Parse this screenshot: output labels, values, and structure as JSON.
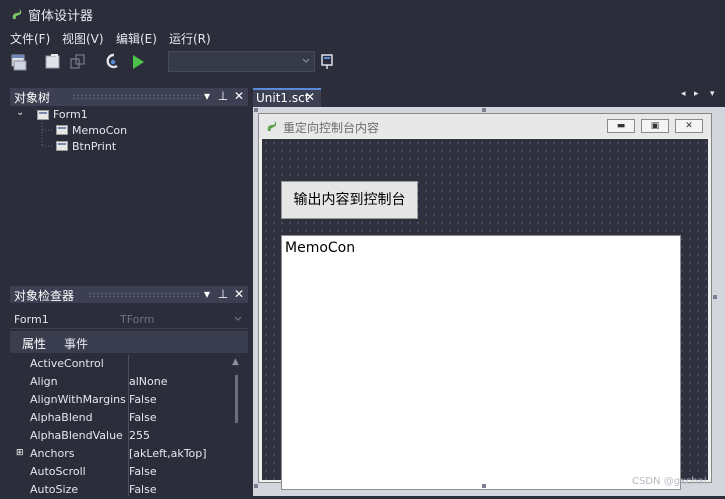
{
  "app": {
    "title": "窗体设计器"
  },
  "menu": [
    {
      "label": "文件(F)"
    },
    {
      "label": "视图(V)"
    },
    {
      "label": "编辑(E)"
    },
    {
      "label": "运行(R)"
    }
  ],
  "toolbar": {
    "combo_value": ""
  },
  "tree_panel": {
    "title": "对象树",
    "nodes": [
      {
        "label": "Form1"
      },
      {
        "label": "MemoCon"
      },
      {
        "label": "BtnPrint"
      }
    ]
  },
  "inspector": {
    "title": "对象检查器",
    "selected_object": "Form1",
    "selected_type": "TForm",
    "tabs": [
      "属性",
      "事件"
    ],
    "properties": [
      {
        "name": "ActiveControl",
        "value": ""
      },
      {
        "name": "Align",
        "value": "alNone"
      },
      {
        "name": "AlignWithMargins",
        "value": "False"
      },
      {
        "name": "AlphaBlend",
        "value": "False"
      },
      {
        "name": "AlphaBlendValue",
        "value": "255"
      },
      {
        "name": "Anchors",
        "value": "[akLeft,akTop]"
      },
      {
        "name": "AutoScroll",
        "value": "False"
      },
      {
        "name": "AutoSize",
        "value": "False"
      }
    ]
  },
  "editor": {
    "tab_label": "Unit1.sct",
    "form": {
      "caption": "重定向控制台内容",
      "button_label": "输出内容到控制台",
      "memo_text": "MemoCon"
    }
  },
  "watermark": "CSDN @gxchai",
  "colors": {
    "accent": "#5a8ad8",
    "panel_header": "#3d4052",
    "background": "#2b2d3a"
  }
}
